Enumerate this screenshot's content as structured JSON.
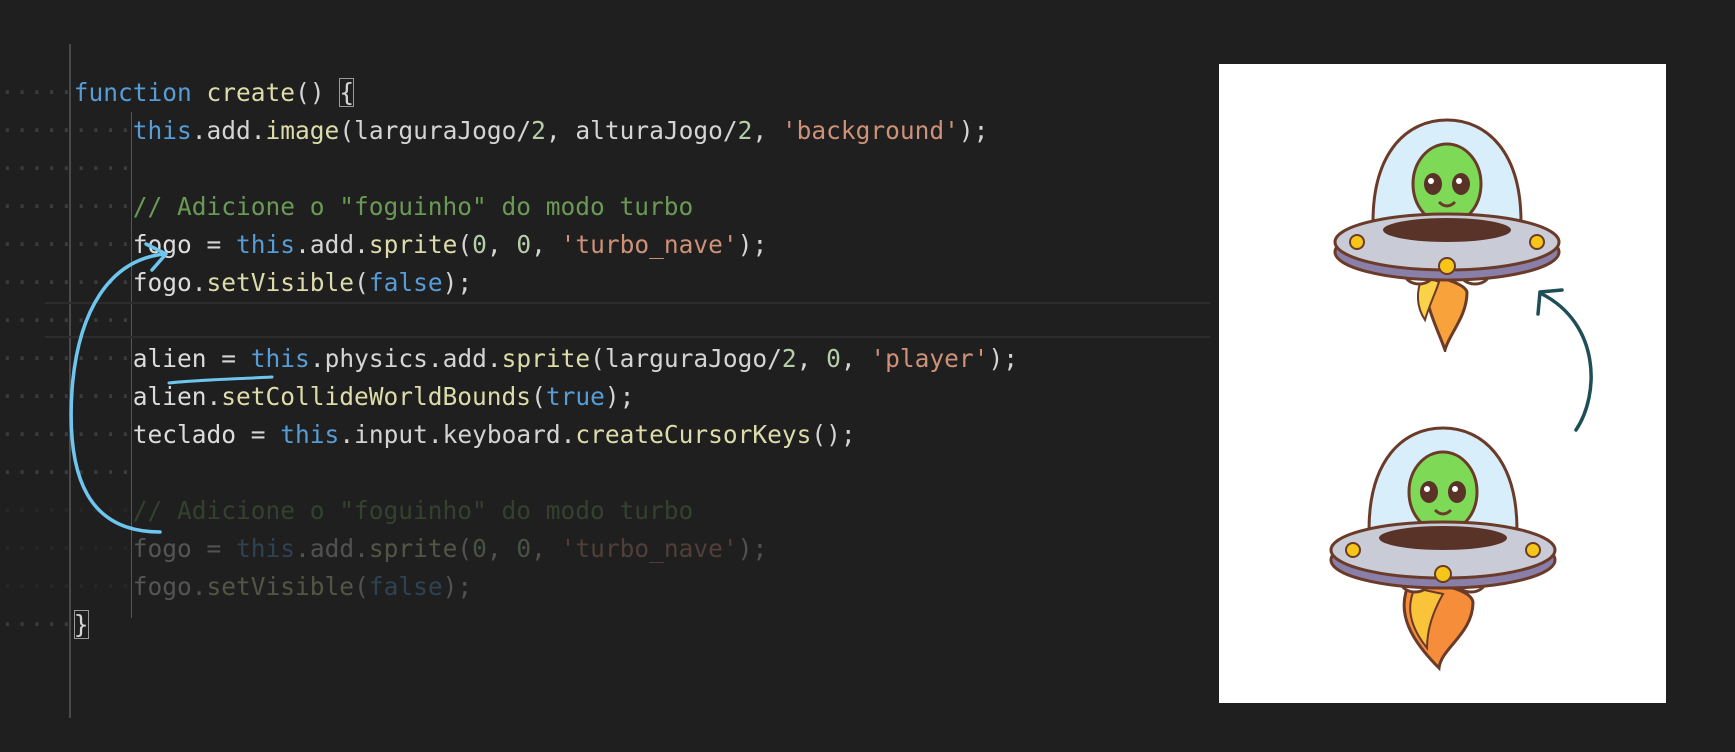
{
  "editor": {
    "lines": [
      {
        "ws": "·····",
        "tokens": [
          {
            "c": "kw",
            "t": "function"
          },
          {
            "c": "",
            "t": " "
          },
          {
            "c": "fn",
            "t": "create"
          },
          {
            "c": "",
            "t": "() "
          },
          {
            "c": "brace",
            "t": "{"
          }
        ]
      },
      {
        "ws": "·········",
        "tokens": [
          {
            "c": "kw",
            "t": "this"
          },
          {
            "c": "",
            "t": ".add."
          },
          {
            "c": "fn",
            "t": "image"
          },
          {
            "c": "",
            "t": "(larguraJogo/"
          },
          {
            "c": "num",
            "t": "2"
          },
          {
            "c": "",
            "t": ", alturaJogo/"
          },
          {
            "c": "num",
            "t": "2"
          },
          {
            "c": "",
            "t": ", "
          },
          {
            "c": "str",
            "t": "'background'"
          },
          {
            "c": "",
            "t": ");"
          }
        ]
      },
      {
        "ws": "·········",
        "tokens": []
      },
      {
        "ws": "·········",
        "tokens": [
          {
            "c": "cm",
            "t": "// Adicione o \"foguinho\" do modo turbo"
          }
        ]
      },
      {
        "ws": "·········",
        "tokens": [
          {
            "c": "var",
            "t": "fogo"
          },
          {
            "c": "",
            "t": " = "
          },
          {
            "c": "kw",
            "t": "this"
          },
          {
            "c": "",
            "t": ".add."
          },
          {
            "c": "fn",
            "t": "sprite"
          },
          {
            "c": "",
            "t": "("
          },
          {
            "c": "num",
            "t": "0"
          },
          {
            "c": "",
            "t": ", "
          },
          {
            "c": "num",
            "t": "0"
          },
          {
            "c": "",
            "t": ", "
          },
          {
            "c": "str",
            "t": "'turbo_nave'"
          },
          {
            "c": "",
            "t": ");"
          }
        ]
      },
      {
        "ws": "·········",
        "tokens": [
          {
            "c": "var",
            "t": "fogo"
          },
          {
            "c": "",
            "t": "."
          },
          {
            "c": "fn",
            "t": "setVisible"
          },
          {
            "c": "",
            "t": "("
          },
          {
            "c": "kw",
            "t": "false"
          },
          {
            "c": "",
            "t": ");"
          }
        ]
      },
      {
        "ws": "·········",
        "tokens": []
      },
      {
        "ws": "·········",
        "tokens": [
          {
            "c": "var",
            "t": "alien"
          },
          {
            "c": "",
            "t": " = "
          },
          {
            "c": "kw",
            "t": "this"
          },
          {
            "c": "",
            "t": ".physics.add."
          },
          {
            "c": "fn",
            "t": "sprite"
          },
          {
            "c": "",
            "t": "(larguraJogo/"
          },
          {
            "c": "num",
            "t": "2"
          },
          {
            "c": "",
            "t": ", "
          },
          {
            "c": "num",
            "t": "0"
          },
          {
            "c": "",
            "t": ", "
          },
          {
            "c": "str",
            "t": "'player'"
          },
          {
            "c": "",
            "t": ");"
          }
        ]
      },
      {
        "ws": "·········",
        "tokens": [
          {
            "c": "var",
            "t": "alien"
          },
          {
            "c": "",
            "t": "."
          },
          {
            "c": "fn",
            "t": "setCollideWorldBounds"
          },
          {
            "c": "",
            "t": "("
          },
          {
            "c": "kw",
            "t": "true"
          },
          {
            "c": "",
            "t": ");"
          }
        ]
      },
      {
        "ws": "·········",
        "tokens": [
          {
            "c": "var",
            "t": "teclado"
          },
          {
            "c": "",
            "t": " = "
          },
          {
            "c": "kw",
            "t": "this"
          },
          {
            "c": "",
            "t": ".input.keyboard."
          },
          {
            "c": "fn",
            "t": "createCursorKeys"
          },
          {
            "c": "",
            "t": "();"
          }
        ]
      },
      {
        "ws": "·········",
        "tokens": []
      },
      {
        "ws": "·········",
        "faded": true,
        "tokens": [
          {
            "c": "cm",
            "t": "// Adicione o \"foguinho\" do modo turbo"
          }
        ]
      },
      {
        "ws": "·········",
        "faded": true,
        "tokens": [
          {
            "c": "var",
            "t": "fogo"
          },
          {
            "c": "",
            "t": " = "
          },
          {
            "c": "kw",
            "t": "this"
          },
          {
            "c": "",
            "t": ".add."
          },
          {
            "c": "fn",
            "t": "sprite"
          },
          {
            "c": "",
            "t": "("
          },
          {
            "c": "num",
            "t": "0"
          },
          {
            "c": "",
            "t": ", "
          },
          {
            "c": "num",
            "t": "0"
          },
          {
            "c": "",
            "t": ", "
          },
          {
            "c": "str",
            "t": "'turbo_nave'"
          },
          {
            "c": "",
            "t": ");"
          }
        ]
      },
      {
        "ws": "·········",
        "faded": true,
        "tokens": [
          {
            "c": "var",
            "t": "fogo"
          },
          {
            "c": "",
            "t": "."
          },
          {
            "c": "fn",
            "t": "setVisible"
          },
          {
            "c": "",
            "t": "("
          },
          {
            "c": "kw",
            "t": "false"
          },
          {
            "c": "",
            "t": ");"
          }
        ]
      },
      {
        "ws": "·····",
        "tokens": [
          {
            "c": "brace",
            "t": "}"
          }
        ]
      }
    ]
  },
  "colors": {
    "background": "#1f1f1f",
    "keyword": "#569cd6",
    "function": "#dcdcaa",
    "string": "#ce9178",
    "number": "#b5cea8",
    "comment": "#6a9955",
    "annotation_left": "#6ec6ef",
    "annotation_right": "#1f4f56"
  },
  "illustration": {
    "icons": [
      "ufo-alien-small-flame-icon",
      "ufo-alien-large-flame-icon"
    ]
  }
}
